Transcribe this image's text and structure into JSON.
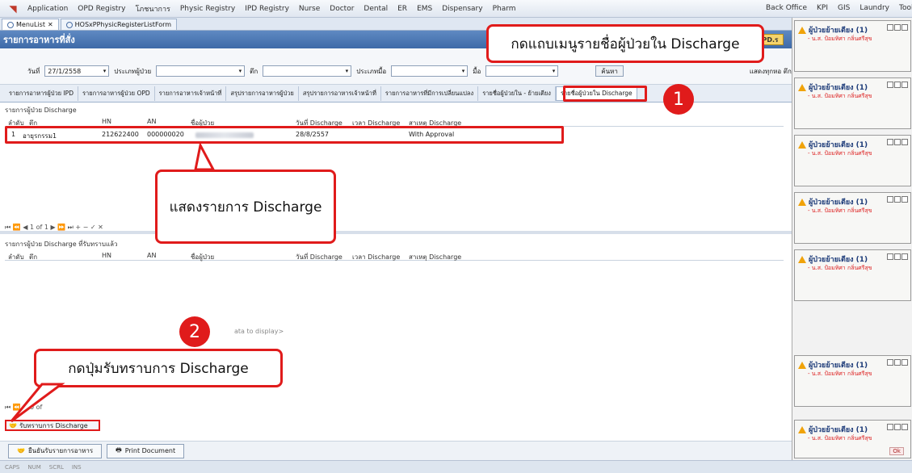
{
  "menubar": {
    "items": [
      "Application",
      "OPD Registry",
      "โภชนาการ",
      "Physic Registry",
      "IPD Registry",
      "Nurse",
      "Doctor",
      "Dental",
      "ER",
      "EMS",
      "Dispensary",
      "Pharm"
    ],
    "right_items": [
      "Back Office",
      "KPI",
      "GIS",
      "Laundry",
      "Tools"
    ]
  },
  "tabs": [
    {
      "label": "MenuList",
      "close": "✕"
    },
    {
      "label": "HOSxPPhysicRegisterListForm"
    }
  ],
  "window": {
    "title": "รายการอาหารที่สั่ง",
    "dept": "OPD.ร"
  },
  "filters": {
    "date_label": "วันที่",
    "date_value": "27/1/2558",
    "patient_type_label": "ประเภทผู้ป่วย",
    "ward_label": "ตึก",
    "meal_type_label": "ประเภทมื้อ",
    "meal_label": "มื้อ",
    "search_button": "ค้นหา",
    "show_all_label": "แสดงทุกหอ ตึก/ผู้ป่วย"
  },
  "subtabs": [
    "รายการอาหารผู้ป่วย IPD",
    "รายการอาหารผู้ป่วย OPD",
    "รายการอาหารเจ้าหน้าที่",
    "สรุปรายการอาหารผู้ป่วย",
    "สรุปรายการอาหารเจ้าหน้าที่",
    "รายการอาหารที่มีการเปลี่ยนแปลง",
    "รายชื่อผู้ป่วยใน - ย้ายเตียง",
    "รายชื่อผู้ป่วยใน Discharge"
  ],
  "grid1": {
    "title": "รายการผู้ป่วย Discharge",
    "columns": [
      "ลำดับ",
      "ตึก",
      "HN",
      "AN",
      "ชื่อผู้ป่วย",
      "วันที่ Discharge",
      "เวลา Discharge",
      "สาเหตุ Discharge"
    ],
    "rows": [
      {
        "no": "1",
        "ward": "อายุรกรรม1",
        "hn": "212622400",
        "an": "000000020",
        "date": "28/8/2557",
        "reason": "With Approval"
      }
    ],
    "pager": "⏮ ⏪ ◀ 1 of 1 ▶ ⏩ ⏭ + − ✓ ✕"
  },
  "grid2": {
    "title": "รายการผู้ป่วย Discharge ที่รับทราบแล้ว",
    "columns": [
      "ลำดับ",
      "ตึก",
      "HN",
      "AN",
      "ชื่อผู้ป่วย",
      "วันที่ Discharge",
      "เวลา Discharge",
      "สาเหตุ Discharge"
    ],
    "empty": "ata to display>",
    "pager": "⏮ ⏪ ◀ 0 of"
  },
  "ack_button": "รับทราบการ Discharge",
  "buttons": {
    "confirm": "ยืนยันรับรายการอาหาร",
    "print": "Print Document"
  },
  "status": [
    "CAPS",
    "NUM",
    "SCRL",
    "INS"
  ],
  "notifications": {
    "title": "ผู้ป่วยย้ายเตียง (1)",
    "body": "- น.ส. ป้อมทิศา กลิ่นศรีสุข",
    "ok": "Ok"
  },
  "annotations": {
    "step1": "กดแถบเมนูรายชื่อผู้ป่วยใน Discharge",
    "step1_num": "1",
    "show_list": "แสดงรายการ Discharge",
    "step2": "กดปุ่มรับทราบการ Discharge",
    "step2_num": "2"
  },
  "colors": {
    "highlight": "#e01b1b",
    "titlebar": "#3e6aa8"
  }
}
